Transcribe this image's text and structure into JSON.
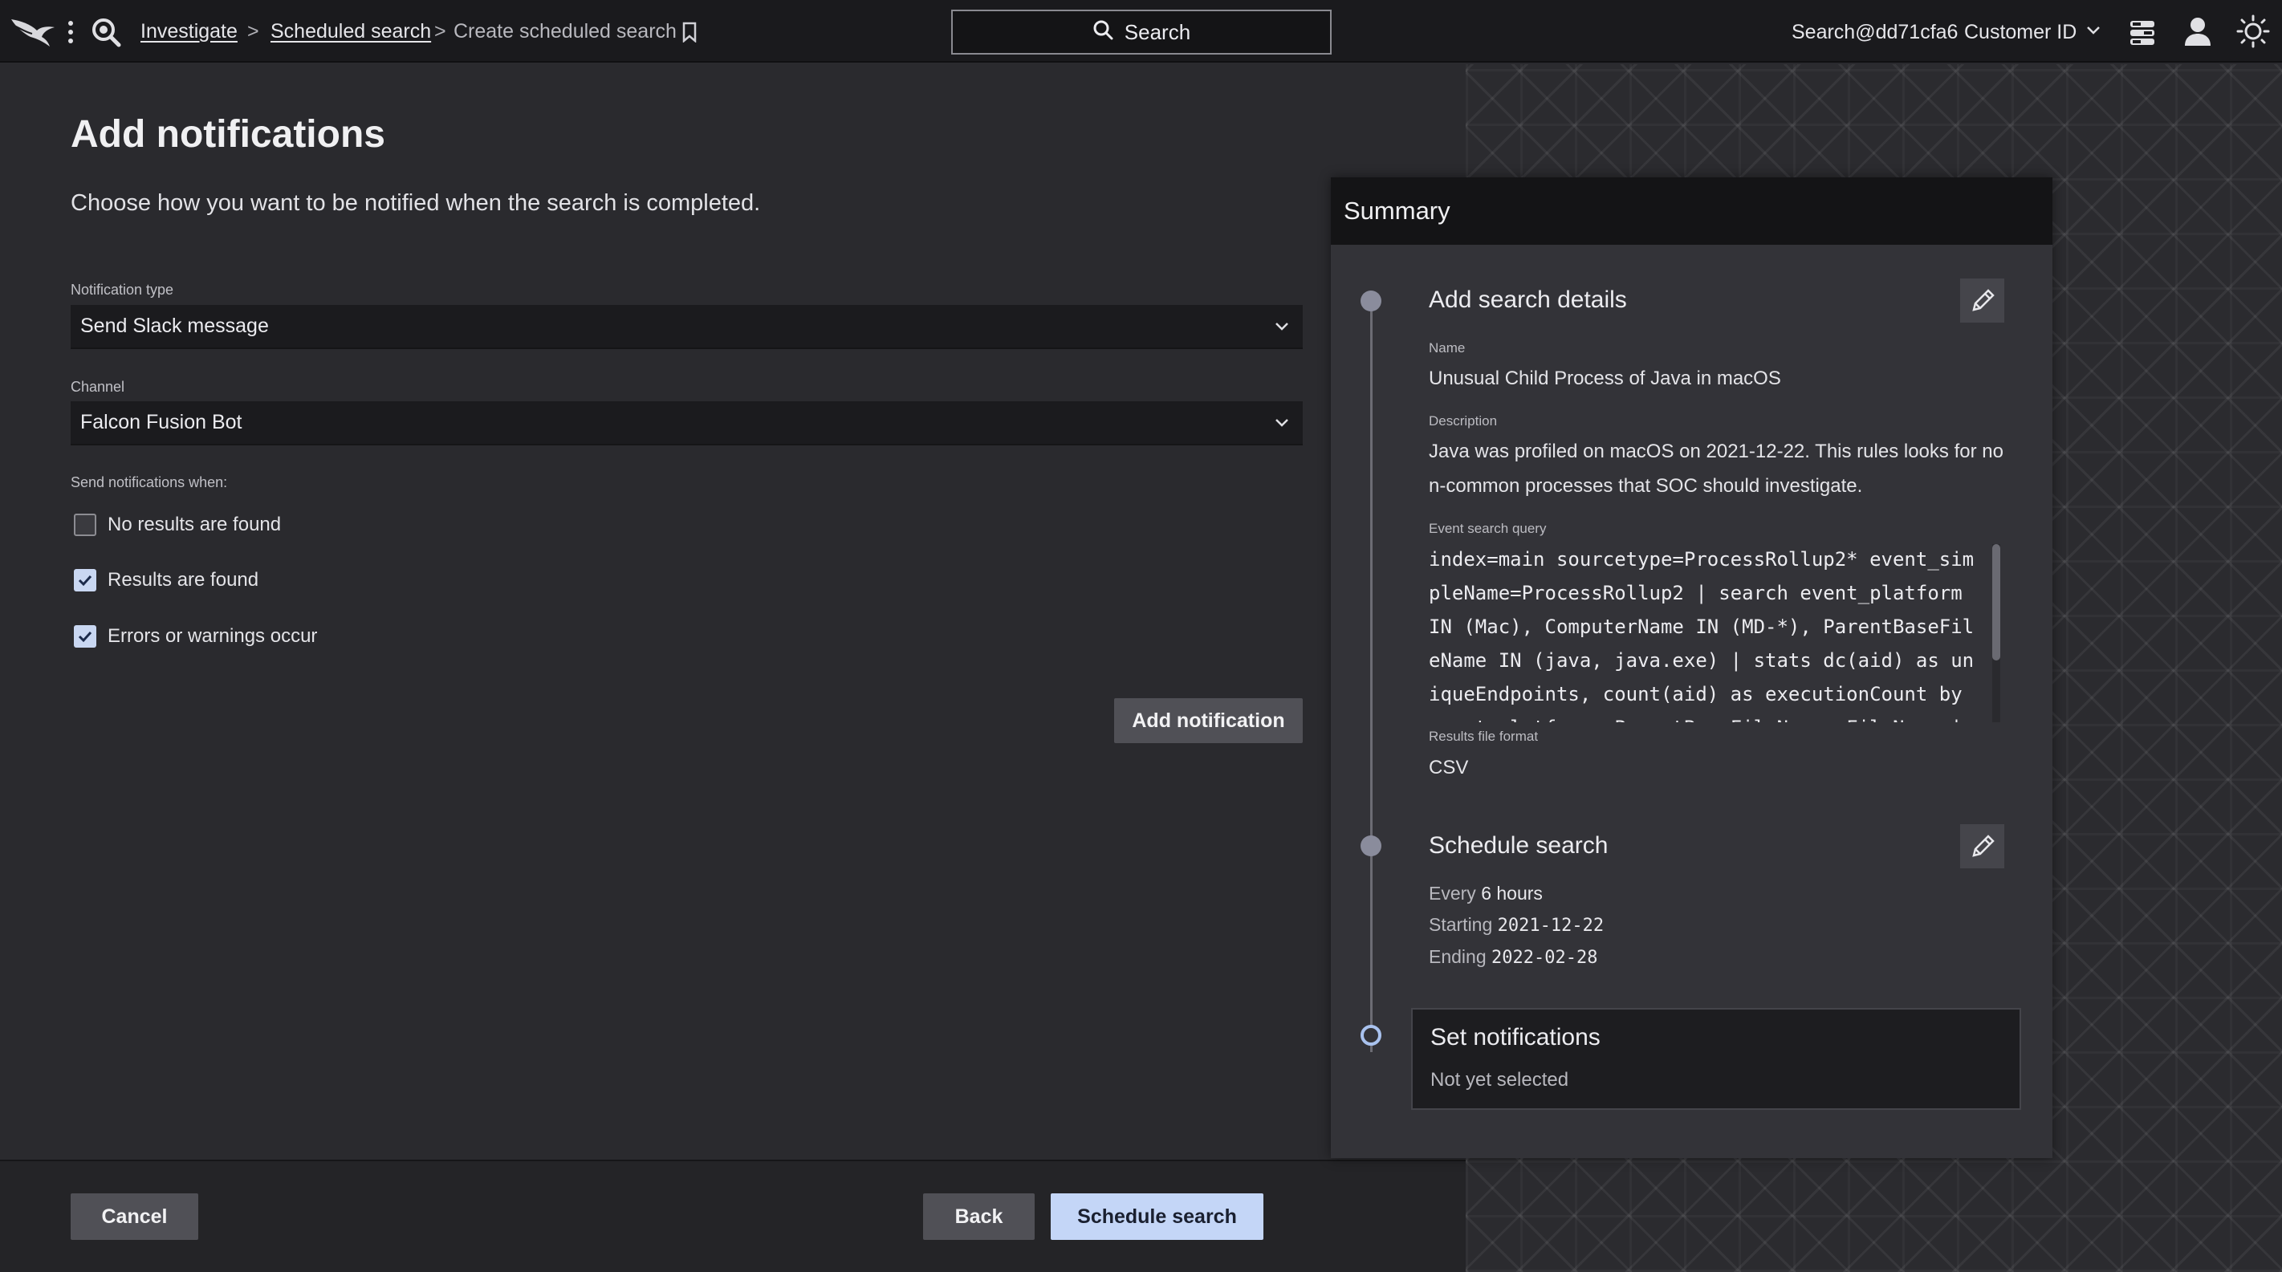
{
  "topbar": {
    "breadcrumb": {
      "investigate": "Investigate",
      "scheduled_search": "Scheduled search",
      "current": "Create scheduled search",
      "separator": ">"
    },
    "search_label": "Search",
    "account": "Search@dd71cfa6",
    "customer_id_label": "Customer ID",
    "icons": [
      "falcon-logo-icon",
      "kebab-menu-icon",
      "search-app-icon",
      "bookmark-icon",
      "search-icon",
      "chevron-down-icon",
      "stack-icon",
      "user-icon",
      "sun-icon"
    ]
  },
  "page": {
    "title": "Add notifications",
    "subtitle": "Choose how you want to be notified when the search is completed."
  },
  "form": {
    "notification_type_label": "Notification type",
    "notification_type_value": "Send Slack message",
    "channel_label": "Channel",
    "channel_value": "Falcon Fusion Bot",
    "send_when_label": "Send notifications when:",
    "conditions": [
      {
        "label": "No results are found",
        "checked": false
      },
      {
        "label": "Results are found",
        "checked": true
      },
      {
        "label": "Errors or warnings occur",
        "checked": true
      }
    ],
    "add_notification_label": "Add notification"
  },
  "footer": {
    "cancel_label": "Cancel",
    "back_label": "Back",
    "schedule_label": "Schedule search"
  },
  "summary": {
    "title": "Summary",
    "details": {
      "title": "Add search details",
      "name_label": "Name",
      "name_value": "Unusual Child Process of Java in macOS",
      "description_label": "Description",
      "description_lines": [
        "Java was profiled on macOS on 2021-12-22. This rules looks for no",
        "n-common processes that SOC should investigate."
      ],
      "query_label": "Event search query",
      "query_lines": [
        "index=main sourcetype=ProcessRollup2* event_sim",
        "pleName=ProcessRollup2 | search event_platform",
        "IN (Mac), ComputerName IN (MD-*), ParentBaseFil",
        "eName IN (java, java.exe) | stats dc(aid) as un",
        "iqueEndpoints, count(aid) as executionCount by",
        "event_platform, ParentBaseFileName, FileName |"
      ],
      "format_label": "Results file format",
      "format_value": "CSV"
    },
    "schedule": {
      "title": "Schedule search",
      "every_label": "Every",
      "every_value": "6 hours",
      "starting_label": "Starting",
      "starting_value": "2021-12-22",
      "ending_label": "Ending",
      "ending_value": "2022-02-28"
    },
    "notifications": {
      "title": "Set notifications",
      "status": "Not yet selected"
    }
  },
  "colors": {
    "accent": "#c4d6f7",
    "checkbox_checked": "#c9d7f2",
    "timeline_current": "#a9c2ee",
    "background": "#2a2a2e",
    "topbar": "#1a1a1d"
  }
}
